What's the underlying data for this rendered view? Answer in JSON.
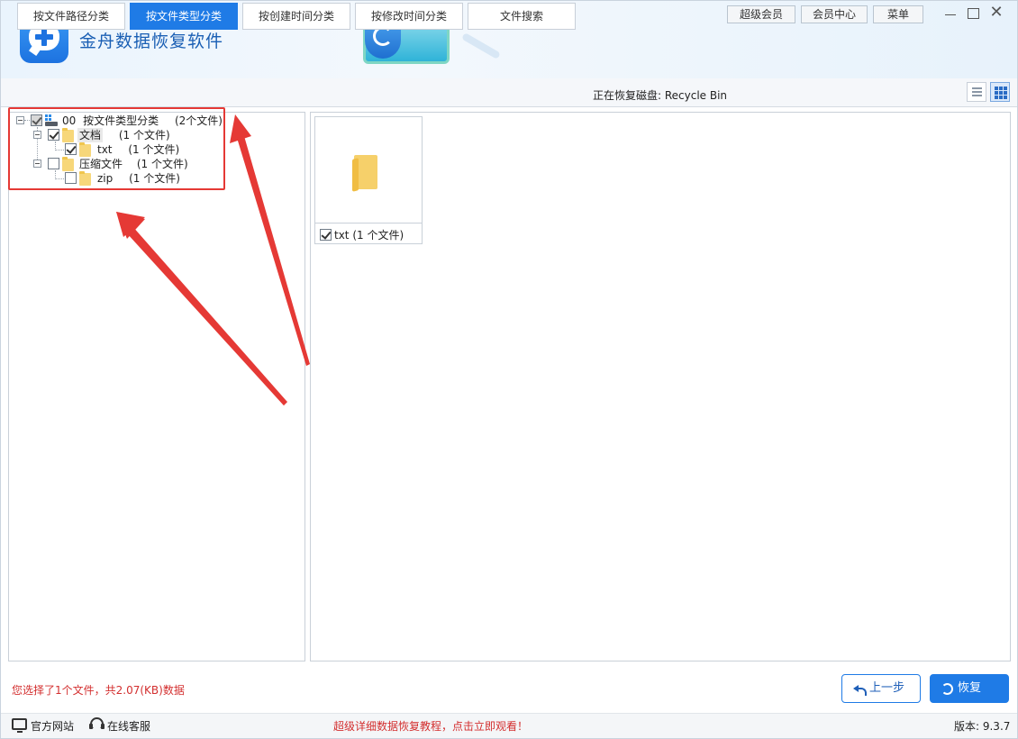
{
  "app": {
    "title": "金舟数据恢复软件"
  },
  "topbar": {
    "super_vip": "超级会员",
    "member_center": "会员中心",
    "menu": "菜单",
    "close_glyph": "✕"
  },
  "tabs": [
    {
      "label": "按文件路径分类",
      "active": false
    },
    {
      "label": "按文件类型分类",
      "active": true
    },
    {
      "label": "按创建时间分类",
      "active": false
    },
    {
      "label": "按修改时间分类",
      "active": false
    },
    {
      "label": "文件搜索",
      "active": false
    }
  ],
  "recovering_disk": "正在恢复磁盘: Recycle Bin",
  "tree": {
    "root": {
      "id": "00",
      "label": "按文件类型分类",
      "count": "(2个文件)",
      "check": "partial"
    },
    "children": [
      {
        "label": "文档",
        "count": "(1 个文件)",
        "check": "checked",
        "children": [
          {
            "label": "txt",
            "count": "(1 个文件)",
            "check": "checked"
          }
        ]
      },
      {
        "label": "压缩文件",
        "count": "(1 个文件)",
        "check": "unchecked",
        "children": [
          {
            "label": "zip",
            "count": "(1 个文件)",
            "check": "unchecked"
          }
        ]
      }
    ]
  },
  "grid_items": [
    {
      "label": "txt (1 个文件)",
      "checked": true
    }
  ],
  "status": {
    "selection": "您选择了1个文件，共2.07(KB)数据"
  },
  "buttons": {
    "prev": "上一步",
    "recover": "恢复"
  },
  "footer": {
    "website": "官方网站",
    "support": "在线客服",
    "promo": "超级详细数据恢复教程，点击立即观看！",
    "version": "版本: 9.3.7"
  },
  "colors": {
    "accent": "#1f7be6",
    "annotation": "#e53935",
    "warning_text": "#d32f2f"
  }
}
